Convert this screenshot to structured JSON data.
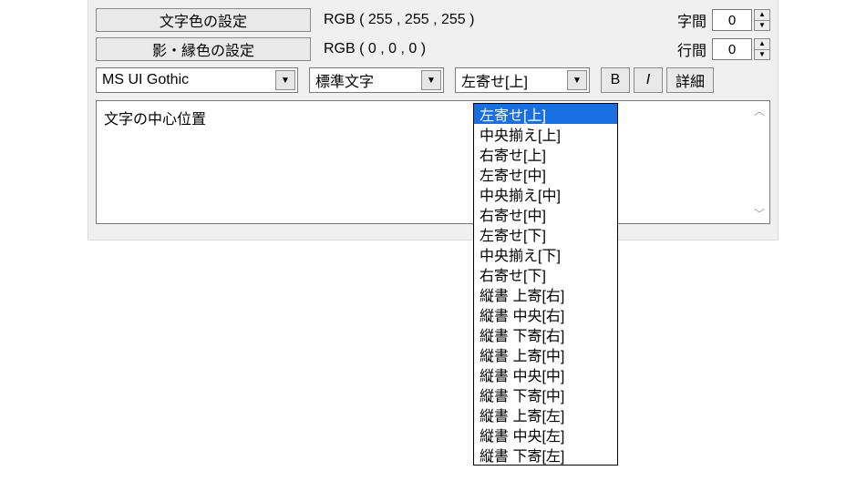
{
  "buttons": {
    "text_color": "文字色の設定",
    "shadow_color": "影・縁色の設定",
    "bold": "B",
    "italic": "I",
    "detail": "詳細"
  },
  "rgb": {
    "text_color": "RGB ( 255 , 255 , 255 )",
    "shadow_color": "RGB ( 0 , 0 , 0 )"
  },
  "spacing": {
    "char_label": "字間",
    "char_value": "0",
    "line_label": "行間",
    "line_value": "0"
  },
  "combos": {
    "font": "MS UI Gothic",
    "style": "標準文字",
    "align": "左寄せ[上]"
  },
  "textarea": {
    "content": "文字の中心位置"
  },
  "align_options": [
    "左寄せ[上]",
    "中央揃え[上]",
    "右寄せ[上]",
    "左寄せ[中]",
    "中央揃え[中]",
    "右寄せ[中]",
    "左寄せ[下]",
    "中央揃え[下]",
    "右寄せ[下]",
    "縦書 上寄[右]",
    "縦書 中央[右]",
    "縦書 下寄[右]",
    "縦書 上寄[中]",
    "縦書 中央[中]",
    "縦書 下寄[中]",
    "縦書 上寄[左]",
    "縦書 中央[左]",
    "縦書 下寄[左]"
  ],
  "align_selected_index": 0
}
